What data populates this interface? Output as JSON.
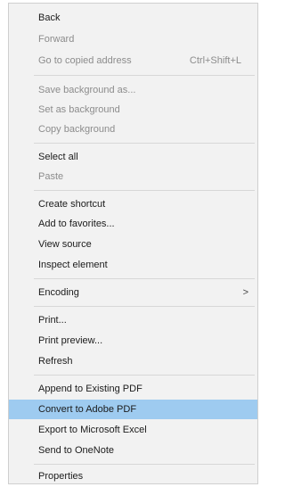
{
  "menu": {
    "items": [
      {
        "label": "Back",
        "enabled": true
      },
      {
        "label": "Forward",
        "enabled": false
      },
      {
        "label": "Go to copied address",
        "enabled": false,
        "shortcut": "Ctrl+Shift+L"
      },
      {
        "label": "Save background as...",
        "enabled": false
      },
      {
        "label": "Set as background",
        "enabled": false
      },
      {
        "label": "Copy background",
        "enabled": false
      },
      {
        "label": "Select all",
        "enabled": true
      },
      {
        "label": "Paste",
        "enabled": false
      },
      {
        "label": "Create shortcut",
        "enabled": true
      },
      {
        "label": "Add to favorites...",
        "enabled": true
      },
      {
        "label": "View source",
        "enabled": true
      },
      {
        "label": "Inspect element",
        "enabled": true
      },
      {
        "label": "Encoding",
        "enabled": true,
        "submenu": ">"
      },
      {
        "label": "Print...",
        "enabled": true
      },
      {
        "label": "Print preview...",
        "enabled": true
      },
      {
        "label": "Refresh",
        "enabled": true
      },
      {
        "label": "Append to Existing PDF",
        "enabled": true
      },
      {
        "label": "Convert to Adobe PDF",
        "enabled": true,
        "highlighted": true
      },
      {
        "label": "Export to Microsoft Excel",
        "enabled": true
      },
      {
        "label": "Send to OneNote",
        "enabled": true
      },
      {
        "label": "Properties",
        "enabled": true
      }
    ]
  }
}
